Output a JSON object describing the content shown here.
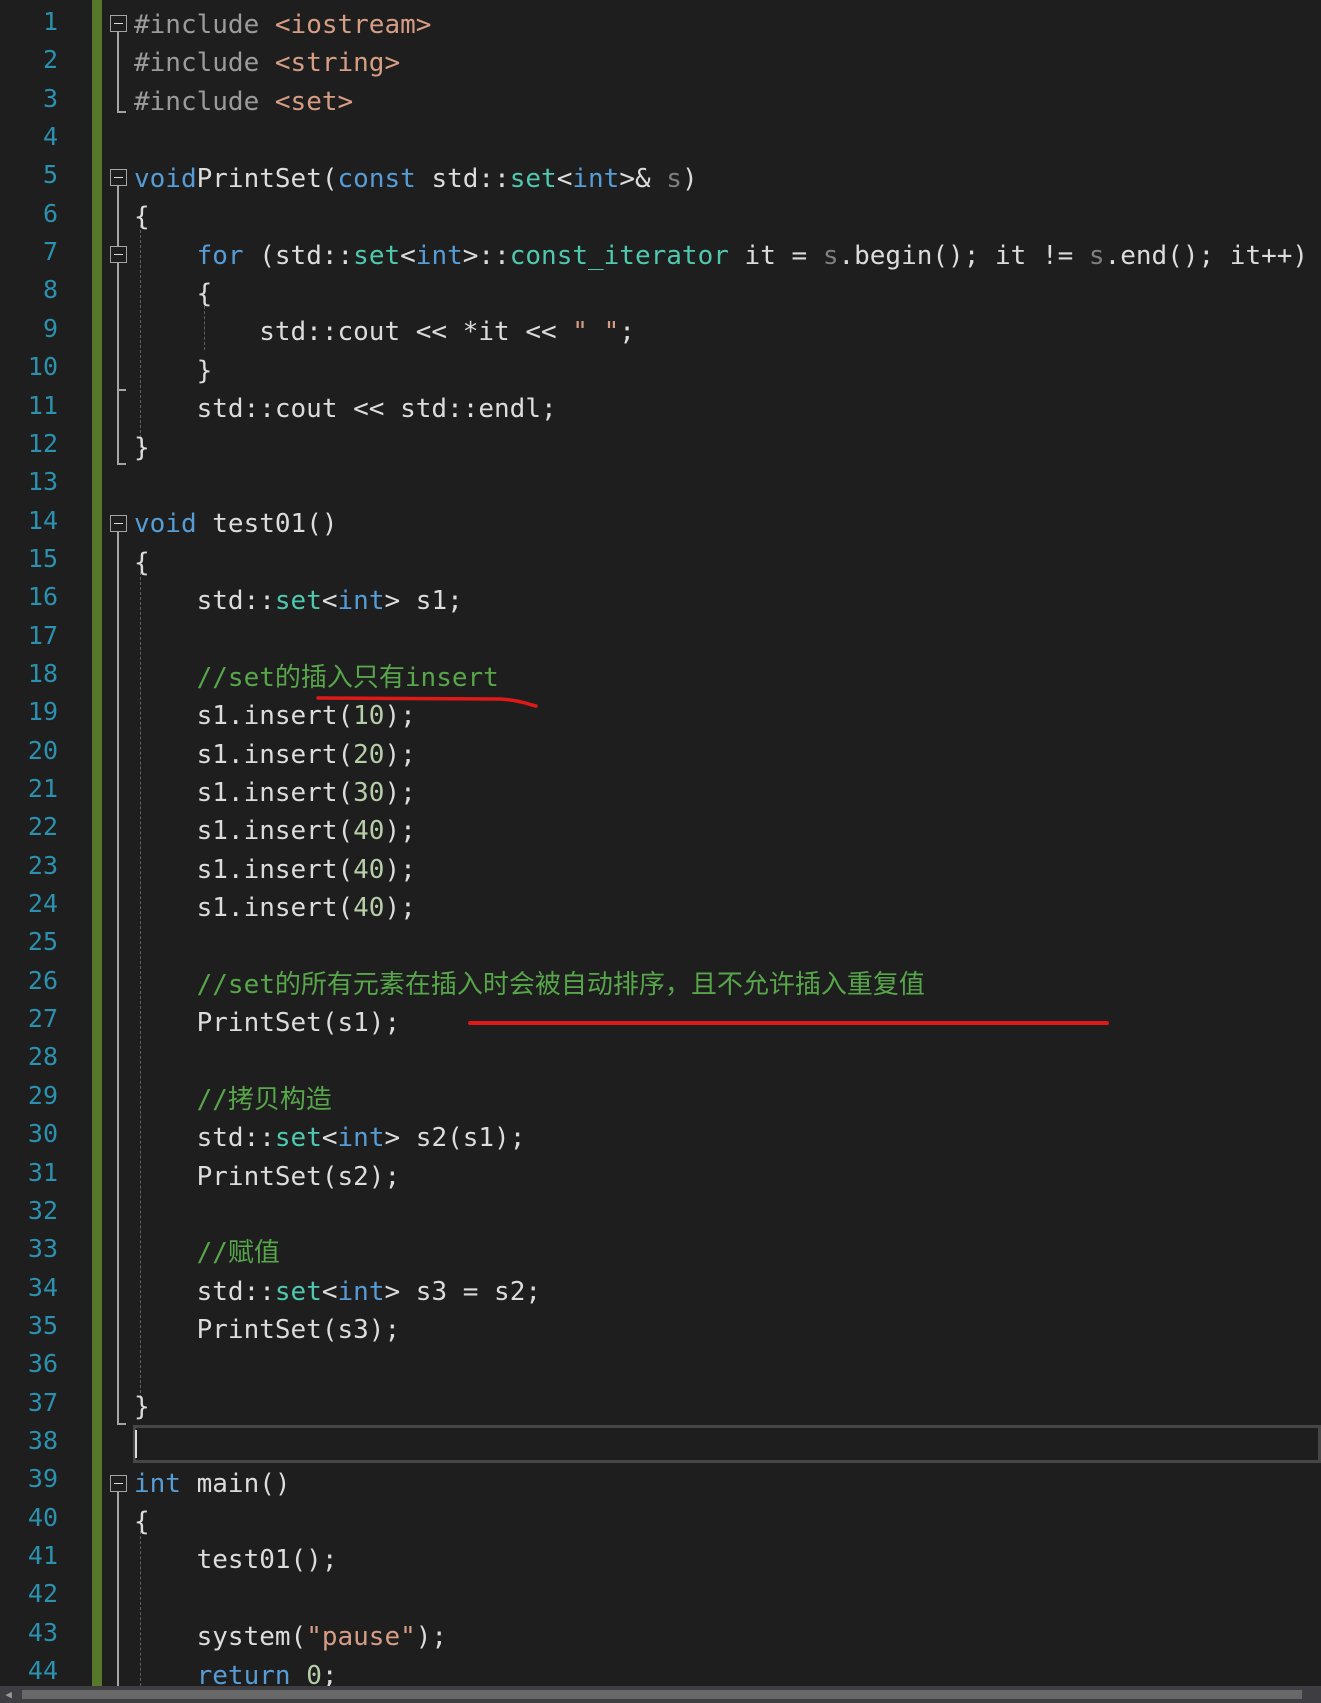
{
  "editor": {
    "line_numbers": [
      "1",
      "2",
      "3",
      "4",
      "5",
      "6",
      "7",
      "8",
      "9",
      "10",
      "11",
      "12",
      "13",
      "14",
      "15",
      "16",
      "17",
      "18",
      "19",
      "20",
      "21",
      "22",
      "23",
      "24",
      "25",
      "26",
      "27",
      "28",
      "29",
      "30",
      "31",
      "32",
      "33",
      "34",
      "35",
      "36",
      "37",
      "38",
      "39",
      "40",
      "41",
      "42",
      "43",
      "44"
    ],
    "lines": {
      "l1": [
        [
          "pp",
          "#include "
        ],
        [
          "inc",
          "<iostream>"
        ]
      ],
      "l2": [
        [
          "pp",
          "#include "
        ],
        [
          "inc",
          "<string>"
        ]
      ],
      "l3": [
        [
          "pp",
          "#include "
        ],
        [
          "inc",
          "<set>"
        ]
      ],
      "l5": [
        [
          "kw",
          "void"
        ],
        [
          "",
          "PrintSet("
        ],
        [
          "kw",
          "const"
        ],
        [
          "",
          " std::"
        ],
        [
          "ty",
          "set"
        ],
        [
          "",
          "<"
        ],
        [
          "kw",
          "int"
        ],
        [
          "",
          ">& "
        ],
        [
          "par",
          "s"
        ],
        [
          "",
          ")"
        ]
      ],
      "l6": [
        [
          "",
          "{"
        ]
      ],
      "l7": [
        [
          "",
          "    "
        ],
        [
          "kw",
          "for"
        ],
        [
          "",
          " (std::"
        ],
        [
          "ty",
          "set"
        ],
        [
          "",
          "<"
        ],
        [
          "kw",
          "int"
        ],
        [
          "",
          ">::"
        ],
        [
          "ty",
          "const_iterator"
        ],
        [
          "",
          " it = "
        ],
        [
          "par",
          "s"
        ],
        [
          "",
          ".begin(); it != "
        ],
        [
          "par",
          "s"
        ],
        [
          "",
          ".end(); it++)"
        ]
      ],
      "l8": [
        [
          "",
          "    {"
        ]
      ],
      "l9": [
        [
          "",
          "        std::cout << *it << "
        ],
        [
          "str",
          "\" \""
        ],
        [
          "",
          ";"
        ]
      ],
      "l10": [
        [
          "",
          "    }"
        ]
      ],
      "l11": [
        [
          "",
          "    std::cout << std::endl;"
        ]
      ],
      "l12": [
        [
          "",
          "}"
        ]
      ],
      "l14": [
        [
          "kw",
          "void"
        ],
        [
          "",
          " test01()"
        ]
      ],
      "l15": [
        [
          "",
          "{"
        ]
      ],
      "l16": [
        [
          "",
          "    std::"
        ],
        [
          "ty",
          "set"
        ],
        [
          "",
          "<"
        ],
        [
          "kw",
          "int"
        ],
        [
          "",
          "> s1;"
        ]
      ],
      "l18": [
        [
          "",
          "    "
        ],
        [
          "com",
          "//set的插入只有insert"
        ]
      ],
      "l19": [
        [
          "",
          "    s1.insert("
        ],
        [
          "num",
          "10"
        ],
        [
          "",
          ");"
        ]
      ],
      "l20": [
        [
          "",
          "    s1.insert("
        ],
        [
          "num",
          "20"
        ],
        [
          "",
          ");"
        ]
      ],
      "l21": [
        [
          "",
          "    s1.insert("
        ],
        [
          "num",
          "30"
        ],
        [
          "",
          ");"
        ]
      ],
      "l22": [
        [
          "",
          "    s1.insert("
        ],
        [
          "num",
          "40"
        ],
        [
          "",
          ");"
        ]
      ],
      "l23": [
        [
          "",
          "    s1.insert("
        ],
        [
          "num",
          "40"
        ],
        [
          "",
          ");"
        ]
      ],
      "l24": [
        [
          "",
          "    s1.insert("
        ],
        [
          "num",
          "40"
        ],
        [
          "",
          ");"
        ]
      ],
      "l26": [
        [
          "",
          "    "
        ],
        [
          "com",
          "//set的所有元素在插入时会被自动排序，且不允许插入重复值"
        ]
      ],
      "l27": [
        [
          "",
          "    PrintSet(s1);"
        ]
      ],
      "l29": [
        [
          "",
          "    "
        ],
        [
          "com",
          "//拷贝构造"
        ]
      ],
      "l30": [
        [
          "",
          "    std::"
        ],
        [
          "ty",
          "set"
        ],
        [
          "",
          "<"
        ],
        [
          "kw",
          "int"
        ],
        [
          "",
          "> s2(s1);"
        ]
      ],
      "l31": [
        [
          "",
          "    PrintSet(s2);"
        ]
      ],
      "l33": [
        [
          "",
          "    "
        ],
        [
          "com",
          "//赋值"
        ]
      ],
      "l34": [
        [
          "",
          "    std::"
        ],
        [
          "ty",
          "set"
        ],
        [
          "",
          "<"
        ],
        [
          "kw",
          "int"
        ],
        [
          "",
          "> s3 = s2;"
        ]
      ],
      "l35": [
        [
          "",
          "    PrintSet(s3);"
        ]
      ],
      "l37": [
        [
          "",
          "}"
        ]
      ],
      "l39": [
        [
          "kw",
          "int"
        ],
        [
          "",
          " main()"
        ]
      ],
      "l40": [
        [
          "",
          "{"
        ]
      ],
      "l41": [
        [
          "",
          "    test01();"
        ]
      ],
      "l43": [
        [
          "",
          "    system("
        ],
        [
          "str",
          "\"pause\""
        ],
        [
          "",
          ");"
        ]
      ],
      "l44": [
        [
          "",
          "    "
        ],
        [
          "kw",
          "return"
        ],
        [
          "",
          " "
        ],
        [
          "num",
          "0"
        ],
        [
          "",
          ";"
        ]
      ]
    }
  },
  "colors": {
    "background": "#1e1e1e",
    "line_number": "#2b91af",
    "keyword": "#569cd6",
    "type": "#4ec9b0",
    "include_path": "#d69d85",
    "comment": "#57a64a",
    "number": "#b5cea8",
    "change_bar": "#57772a",
    "annotation": "#e01818"
  },
  "icons": {
    "fold": "collapse-box-icon",
    "scroll_left": "arrow-left-icon"
  }
}
